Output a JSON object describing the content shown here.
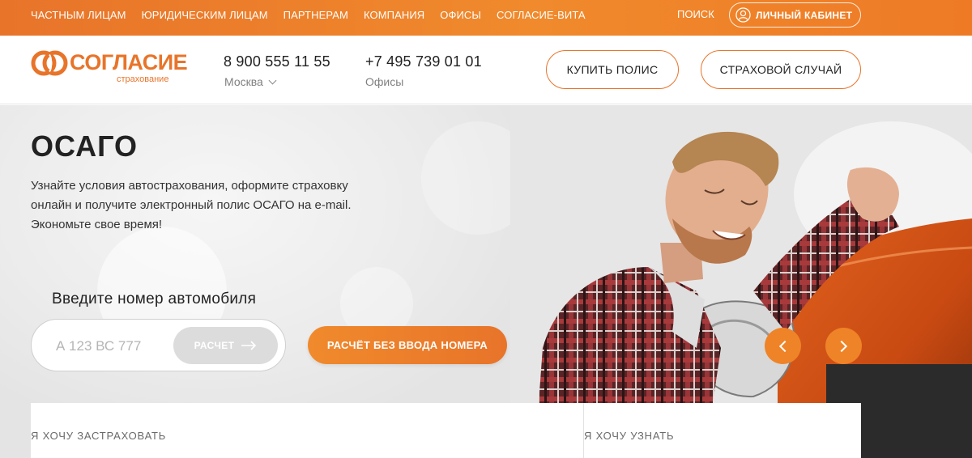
{
  "topnav": {
    "items": [
      {
        "label": "ЧАСТНЫМ ЛИЦАМ"
      },
      {
        "label": "ЮРИДИЧЕСКИМ ЛИЦАМ"
      },
      {
        "label": "ПАРТНЕРАМ"
      },
      {
        "label": "КОМПАНИЯ"
      },
      {
        "label": "ОФИСЫ"
      },
      {
        "label": "СОГЛАСИЕ-ВИТА"
      }
    ],
    "search_label": "ПОИСК",
    "cabinet_label": "ЛИЧНЫЙ КАБИНЕТ"
  },
  "header": {
    "logo_name": "СОГЛАСИЕ",
    "logo_sub": "страхование",
    "phone_1": "8 900 555 11 55",
    "city": "Москва",
    "phone_2": "+7 495 739 01 01",
    "offices_label": "Офисы",
    "buy_label": "КУПИТЬ ПОЛИС",
    "claim_label": "СТРАХОВОЙ СЛУЧАЙ"
  },
  "hero": {
    "title": "ОСАГО",
    "description": "Узнайте условия автострахования, оформите страховку онлайн и получите электронный полис ОСАГО на e-mail. Экономьте свое время!",
    "plate_label": "Введите номер автомобиля",
    "plate_placeholder": "А 123 ВС 777",
    "calc_label": "РАСЧЕТ",
    "no_number_label": "РАСЧЁТ БЕЗ ВВОДА НОМЕРА"
  },
  "panel": {
    "left_label": "Я ХОЧУ ЗАСТРАХОВАТЬ",
    "right_label": "Я ХОЧУ УЗНАТЬ"
  },
  "colors": {
    "accent": "#e8742a",
    "accent_light": "#f08a2c",
    "disabled_button": "#dcdcdc"
  },
  "icons": {
    "user": "user-icon",
    "logo": "logo-rings-icon",
    "calc_arrow": "arrow-right-icon",
    "prev": "chevron-left-icon",
    "next": "chevron-right-icon",
    "city": "chevron-down-icon"
  }
}
